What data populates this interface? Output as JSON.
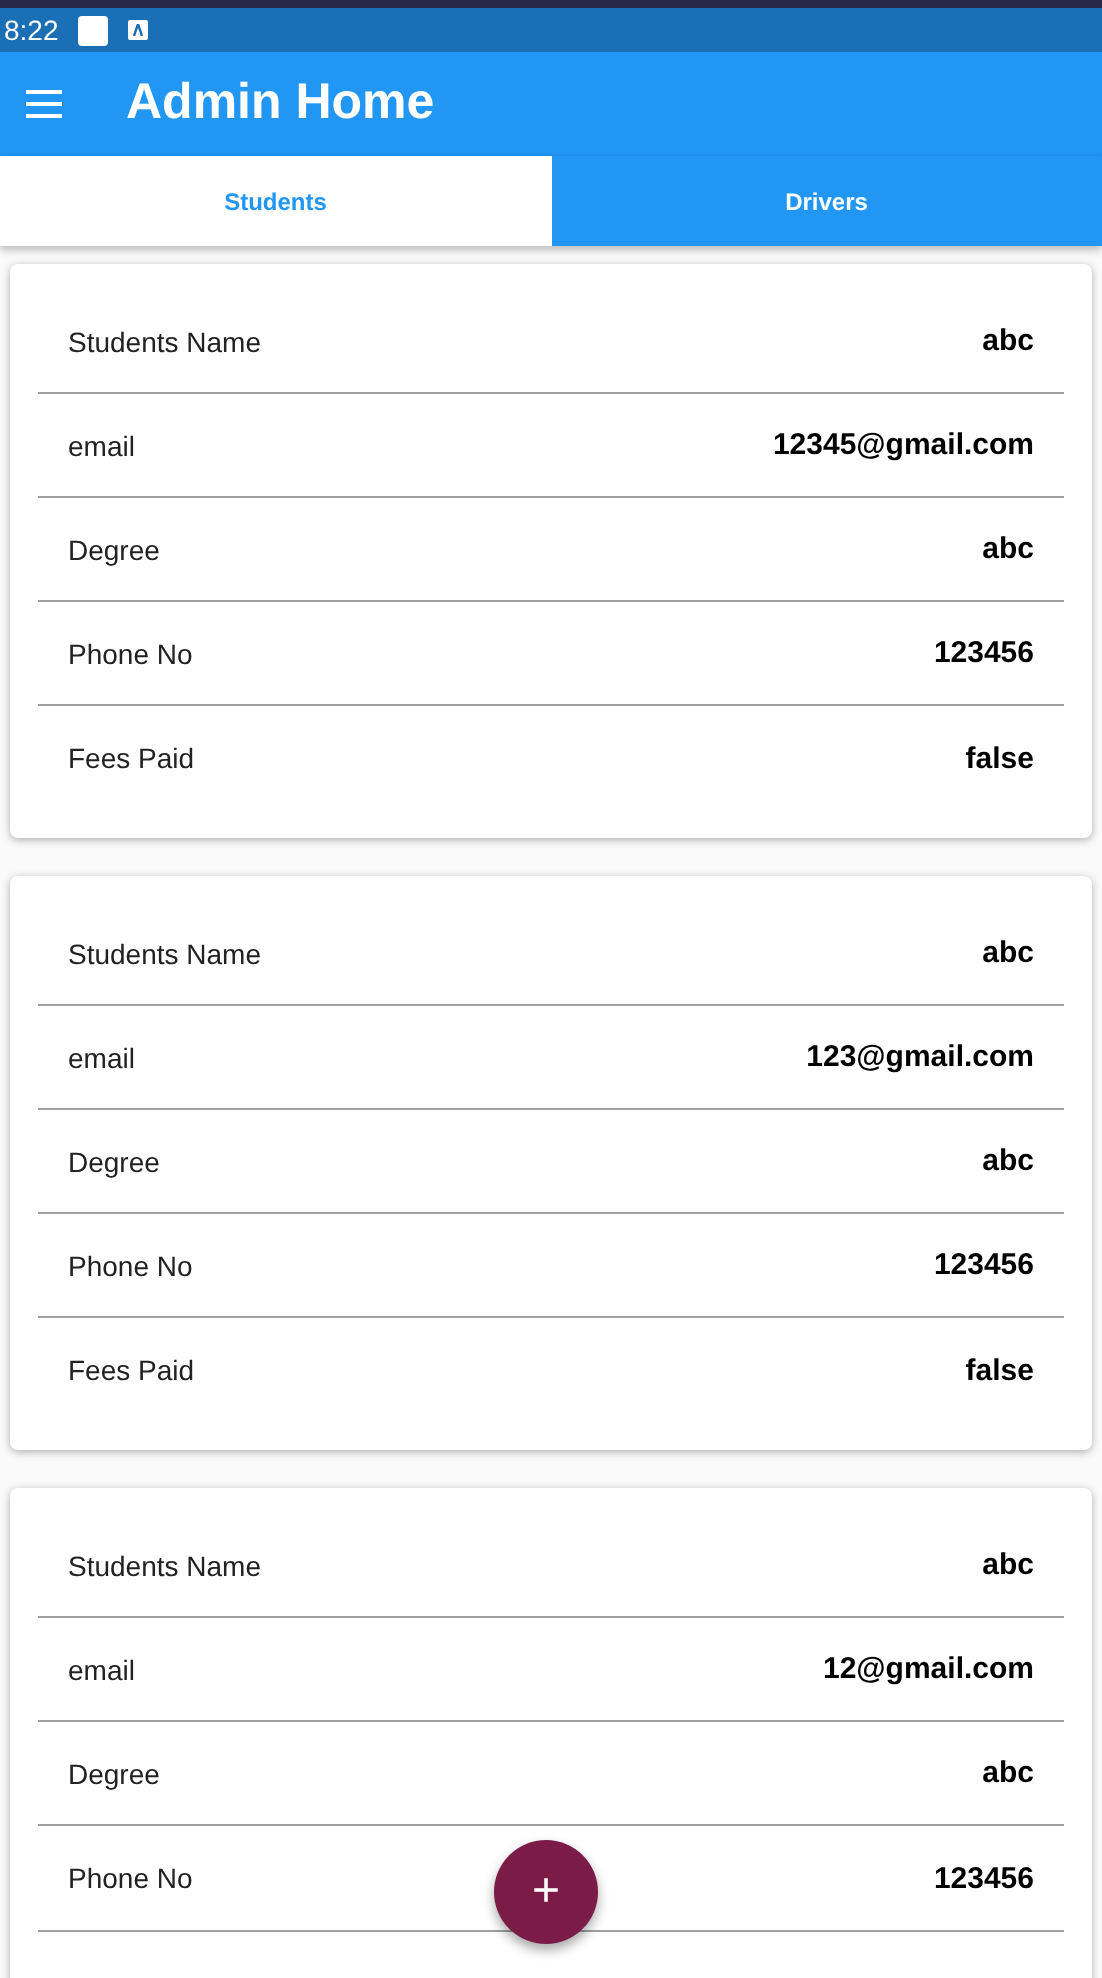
{
  "status_bar": {
    "time": "8:22"
  },
  "app_bar": {
    "title": "Admin Home"
  },
  "tabs": [
    {
      "label": "Students",
      "selected": true
    },
    {
      "label": "Drivers",
      "selected": false
    }
  ],
  "cards": [
    {
      "rows": [
        {
          "label": "Students Name",
          "value": "abc"
        },
        {
          "label": "email",
          "value": "12345@gmail.com"
        },
        {
          "label": "Degree",
          "value": "abc"
        },
        {
          "label": "Phone No",
          "value": "123456"
        },
        {
          "label": "Fees Paid",
          "value": "false"
        }
      ]
    },
    {
      "rows": [
        {
          "label": "Students Name",
          "value": "abc"
        },
        {
          "label": "email",
          "value": "123@gmail.com"
        },
        {
          "label": "Degree",
          "value": "abc"
        },
        {
          "label": "Phone No",
          "value": "123456"
        },
        {
          "label": "Fees Paid",
          "value": "false"
        }
      ]
    },
    {
      "rows": [
        {
          "label": "Students Name",
          "value": "abc"
        },
        {
          "label": "email",
          "value": "12@gmail.com"
        },
        {
          "label": "Degree",
          "value": "abc"
        },
        {
          "label": "Phone No",
          "value": "123456"
        }
      ],
      "cut_off": true
    }
  ],
  "fab": {
    "label": "+"
  }
}
